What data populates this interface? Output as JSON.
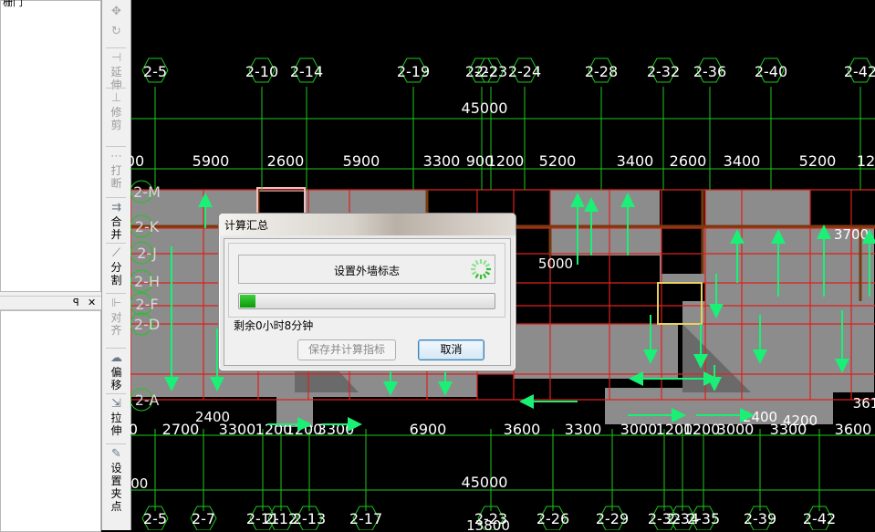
{
  "left_panel": {
    "top_cut_text": "栅门",
    "pin_icon": "pin-icon",
    "close_icon": "close-icon",
    "pin_glyph": "ꟼ",
    "close_glyph": "✕"
  },
  "toolbar": {
    "items": [
      {
        "icon": "move-icon",
        "glyph": "✥",
        "label": "",
        "disabled": true
      },
      {
        "icon": "rotate-icon",
        "glyph": "↻",
        "label": "",
        "disabled": true
      },
      {
        "icon": "extend-icon",
        "glyph": "⊣",
        "label": "延\n伸",
        "disabled": true
      },
      {
        "icon": "trim-icon",
        "glyph": "⊥",
        "label": "修\n剪",
        "disabled": true
      },
      {
        "icon": "break-icon",
        "glyph": "⋯",
        "label": "打\n断",
        "disabled": true
      },
      {
        "icon": "merge-icon",
        "glyph": "⇉",
        "label": "合\n并",
        "disabled": false
      },
      {
        "icon": "split-icon",
        "glyph": "⟋",
        "label": "分\n割",
        "disabled": false
      },
      {
        "icon": "align-icon",
        "glyph": "⊩",
        "label": "对\n齐",
        "disabled": true
      },
      {
        "icon": "offset-icon",
        "glyph": "☁",
        "label": "偏\n移",
        "disabled": false
      },
      {
        "icon": "stretch-icon",
        "glyph": "⇲",
        "label": "拉\n伸",
        "disabled": false
      },
      {
        "icon": "grip-icon",
        "glyph": "✎",
        "label": "设\n置\n夹\n点",
        "disabled": false
      }
    ]
  },
  "canvas": {
    "top_axes": [
      "2-5",
      "2-10",
      "2-14",
      "2-19",
      "2-22",
      "2-23",
      "2-24",
      "2-28",
      "2-32",
      "2-36",
      "2-40",
      "2-42"
    ],
    "bottom_axes": [
      "2-5",
      "2-7",
      "2-11",
      "2-12",
      "2-13",
      "2-17",
      "2-23",
      "2-26",
      "2-29",
      "2-32",
      "2-34",
      "2-35",
      "2-39",
      "2-42"
    ],
    "row_axes": [
      "2-M",
      "2-K",
      "2-J",
      "2-H",
      "2-F",
      "2-D",
      "2-A"
    ],
    "top_total": "45000",
    "bottom_total": "45000",
    "top_dims": [
      "00",
      "5900",
      "2600",
      "5900",
      "3300",
      "900",
      "1200",
      "5200",
      "3400",
      "2600",
      "3400",
      "5200",
      "12"
    ],
    "bottom_dims": [
      "0",
      "2700",
      "3300",
      "1200",
      "1200",
      "3300",
      "6900",
      "3600",
      "3300",
      "3000",
      "1200",
      "1200",
      "3000",
      "3300",
      "3600"
    ],
    "misc_dims": [
      "5000",
      "4200",
      "361",
      "2400",
      "2400",
      "3700",
      "13800",
      "300"
    ],
    "colors": {
      "grid": "#1ec81e",
      "wall": "#e0201c",
      "slab": "#8c8c8c",
      "arrow": "#19f075",
      "beam": "#7a3a10"
    }
  },
  "dialog": {
    "title": "计算汇总",
    "status_text": "设置外墙标志",
    "progress_fraction": 0.06,
    "remaining_text": "剩余0小时8分钟",
    "save_button": "保存并计算指标",
    "cancel_button": "取消"
  }
}
